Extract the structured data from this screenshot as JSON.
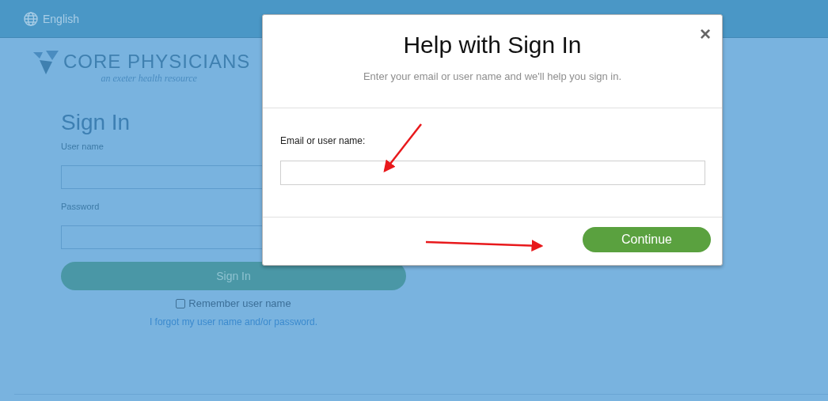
{
  "top_bar": {
    "language": "English"
  },
  "logo": {
    "name": "CORE PHYSICIANS",
    "tagline": "an exeter health resource"
  },
  "sign_in": {
    "title": "Sign In",
    "username_label": "User name",
    "password_label": "Password",
    "button": "Sign In",
    "remember": {
      "label": "Remember user name",
      "checked": false
    },
    "forgot_link": "I forgot my user name and/or password."
  },
  "dialog": {
    "title": "Help with Sign In",
    "close": "×",
    "subtitle": "Enter your email or user name and we'll help you sign in.",
    "field_label": "Email or user name:",
    "button": "Continue"
  }
}
